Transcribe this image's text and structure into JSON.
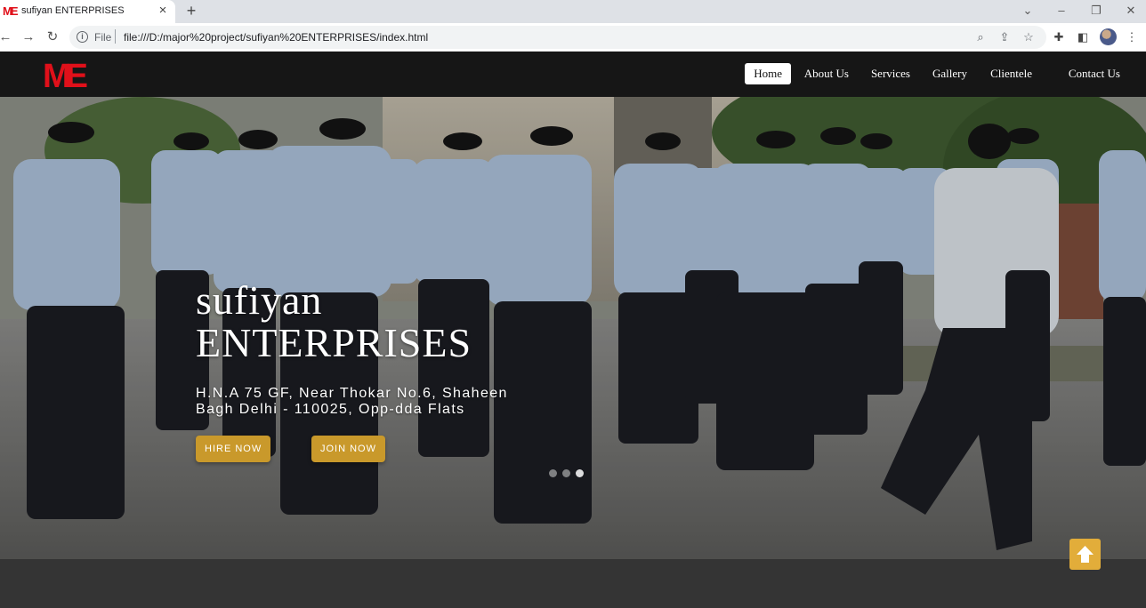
{
  "browser": {
    "tab_title": "sufiyan ENTERPRISES",
    "tab_favicon_text": "ME",
    "tab_close": "×",
    "new_tab": "+",
    "url_scheme": "File",
    "url": "file:///D:/major%20project/sufiyan%20ENTERPRISES/index.html",
    "icons": [
      "back-icon",
      "forward-icon",
      "reload-icon",
      "info-icon",
      "zoom-icon",
      "share-icon",
      "star-icon",
      "extensions-icon",
      "side-panel-icon",
      "profile-avatar",
      "menu-icon",
      "minimize-icon",
      "restore-icon",
      "close-window-icon",
      "tab-search-icon"
    ]
  },
  "site": {
    "logo_text": "ME",
    "nav": [
      {
        "label": "Home",
        "active": true
      },
      {
        "label": "About Us",
        "active": false
      },
      {
        "label": "Services",
        "active": false
      },
      {
        "label": "Gallery",
        "active": false
      },
      {
        "label": "Clientele",
        "active": false
      },
      {
        "label": "Contact Us",
        "active": false
      }
    ]
  },
  "hero": {
    "title_line1": "sufiyan",
    "title_line2": "ENTERPRISES",
    "address": "H.N.A 75 GF, Near Thokar No.6, Shaheen Bagh Delhi - 110025, Opp-dda Flats",
    "hire_button": "HIRE NOW",
    "join_button": "JOIN NOW",
    "carousel_slides": 3,
    "carousel_active_index": 2
  },
  "back_to_top_icon": "arrow-up-icon",
  "colors": {
    "accent_gold": "#c9992b",
    "back_to_top": "#e2ad3a",
    "nav_background": "#161616",
    "logo_red": "#e0101a"
  }
}
